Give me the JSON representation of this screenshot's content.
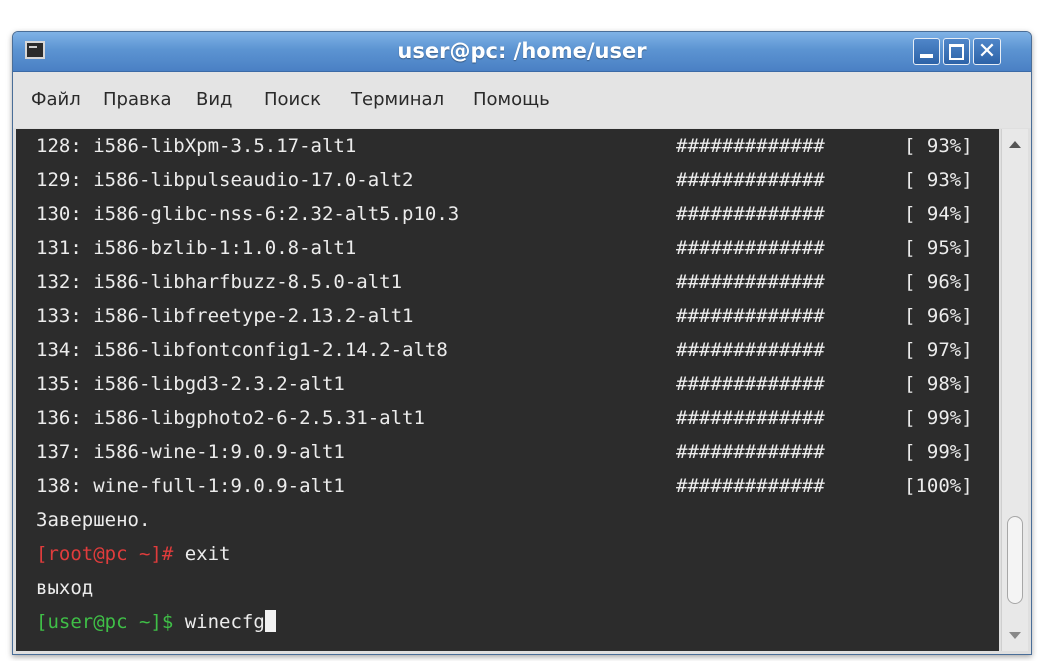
{
  "window": {
    "title": "user@pc: /home/user",
    "close_glyph": "✕"
  },
  "menu": {
    "items": [
      "Файл",
      "Правка",
      "Вид",
      "Поиск",
      "Терминал",
      "Помощь"
    ]
  },
  "terminal": {
    "packages": [
      {
        "line": "128: i586-libXpm-3.5.17-alt1",
        "bar": "#############",
        "pct": "[ 93%]"
      },
      {
        "line": "129: i586-libpulseaudio-17.0-alt2",
        "bar": "#############",
        "pct": "[ 93%]"
      },
      {
        "line": "130: i586-glibc-nss-6:2.32-alt5.p10.3",
        "bar": "#############",
        "pct": "[ 94%]"
      },
      {
        "line": "131: i586-bzlib-1:1.0.8-alt1",
        "bar": "#############",
        "pct": "[ 95%]"
      },
      {
        "line": "132: i586-libharfbuzz-8.5.0-alt1",
        "bar": "#############",
        "pct": "[ 96%]"
      },
      {
        "line": "133: i586-libfreetype-2.13.2-alt1",
        "bar": "#############",
        "pct": "[ 96%]"
      },
      {
        "line": "134: i586-libfontconfig1-2.14.2-alt8",
        "bar": "#############",
        "pct": "[ 97%]"
      },
      {
        "line": "135: i586-libgd3-2.3.2-alt1",
        "bar": "#############",
        "pct": "[ 98%]"
      },
      {
        "line": "136: i586-libgphoto2-6-2.5.31-alt1",
        "bar": "#############",
        "pct": "[ 99%]"
      },
      {
        "line": "137: i586-wine-1:9.0.9-alt1",
        "bar": "#############",
        "pct": "[ 99%]"
      },
      {
        "line": "138: wine-full-1:9.0.9-alt1",
        "bar": "#############",
        "pct": "[100%]"
      }
    ],
    "done_text": "Завершено.",
    "root_prompt": "[root@pc ~]#",
    "root_command": "exit",
    "exit_output": "выход",
    "user_prompt": "[user@pc ~]$",
    "user_command": "winecfg"
  },
  "colors": {
    "titlebar": "#5c94d2",
    "terminal_bg": "#2c2c2c",
    "root_prompt": "#e03c3c",
    "user_prompt": "#3fbf47"
  },
  "icons": {
    "window_icon": "terminal-icon",
    "minimize": "minimize-icon",
    "maximize": "maximize-icon",
    "close": "close-icon",
    "scroll_up": "chevron-up-icon",
    "scroll_down": "chevron-down-icon"
  }
}
